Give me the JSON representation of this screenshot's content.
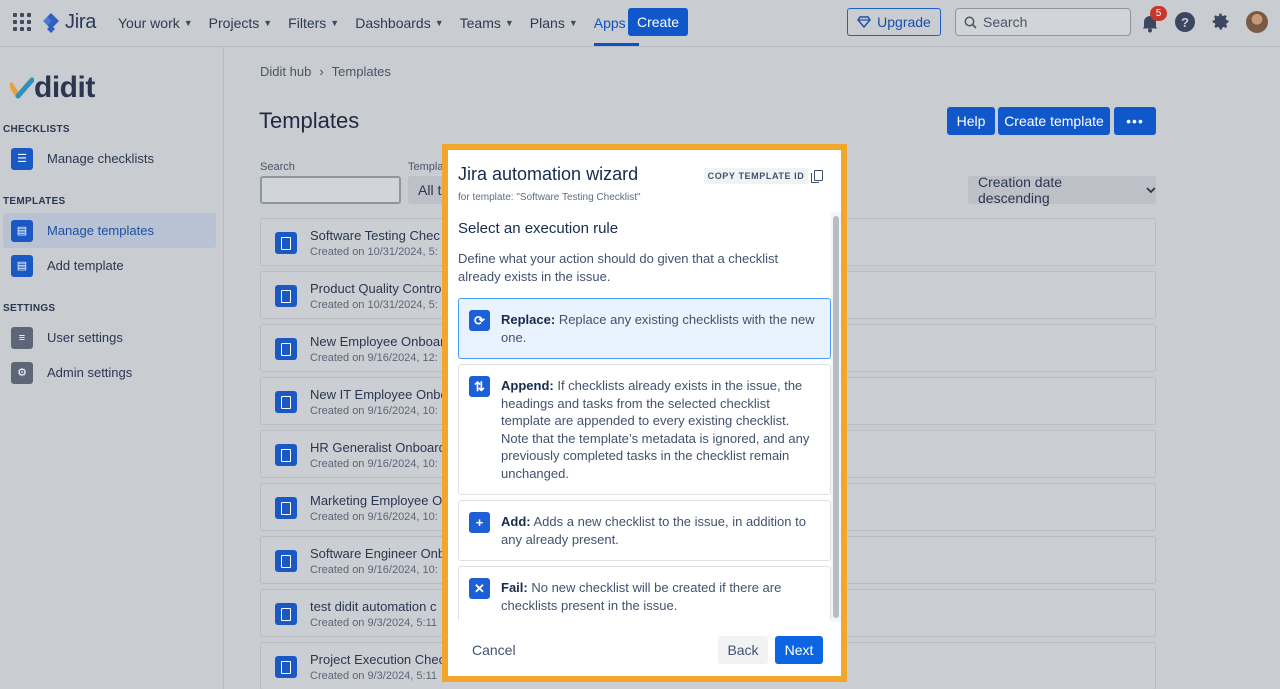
{
  "topnav": {
    "product": "Jira",
    "items": [
      {
        "label": "Your work"
      },
      {
        "label": "Projects"
      },
      {
        "label": "Filters"
      },
      {
        "label": "Dashboards"
      },
      {
        "label": "Teams"
      },
      {
        "label": "Plans"
      },
      {
        "label": "Apps",
        "active": true
      }
    ],
    "create_label": "Create",
    "upgrade_label": "Upgrade",
    "search_placeholder": "Search",
    "notification_count": "5",
    "help_glyph": "?",
    "icons": [
      "app-grid-icon",
      "upgrade-gem-icon",
      "search-icon",
      "bell-icon",
      "help-icon",
      "gear-icon",
      "avatar"
    ]
  },
  "sidebar": {
    "logo": "didit",
    "sections": [
      {
        "title": "CHECKLISTS",
        "items": [
          {
            "label": "Manage checklists",
            "icon": "checklist-icon"
          }
        ]
      },
      {
        "title": "TEMPLATES",
        "items": [
          {
            "label": "Manage templates",
            "icon": "template-icon",
            "selected": true
          },
          {
            "label": "Add template",
            "icon": "add-template-icon"
          }
        ]
      },
      {
        "title": "SETTINGS",
        "items": [
          {
            "label": "User settings",
            "icon": "sliders-icon"
          },
          {
            "label": "Admin settings",
            "icon": "admin-gear-icon"
          }
        ]
      }
    ]
  },
  "main": {
    "breadcrumb": [
      "Didit hub",
      "Templates"
    ],
    "breadcrumb_sep": "›",
    "title": "Templates",
    "help_label": "Help",
    "create_template_label": "Create template",
    "more_label": "•••",
    "search_label": "Search",
    "template_filter_label": "Templa",
    "template_filter_value": "All t",
    "sort_value": "Creation date descending",
    "templates": [
      {
        "name": "Software Testing Chec",
        "created": "Created on 10/31/2024, 5:"
      },
      {
        "name": "Product Quality Contro",
        "created": "Created on 10/31/2024, 5:"
      },
      {
        "name": "New Employee Onboar",
        "created": "Created on 9/16/2024, 12:"
      },
      {
        "name": "New IT Employee Onbo",
        "created": "Created on 9/16/2024, 10:"
      },
      {
        "name": "HR Generalist Onboard",
        "created": "Created on 9/16/2024, 10:"
      },
      {
        "name": "Marketing Employee O",
        "created": "Created on 9/16/2024, 10:"
      },
      {
        "name": "Software Engineer Onb",
        "created": "Created on 9/16/2024, 10:"
      },
      {
        "name": "test didit automation c",
        "created": "Created on 9/3/2024, 5:11"
      },
      {
        "name": "Project Execution Chec",
        "created": "Created on 9/3/2024, 5:11"
      }
    ]
  },
  "modal": {
    "title": "Jira automation wizard",
    "subtitle": "for template: \"Software Testing Checklist\"",
    "copy_id_label": "COPY TEMPLATE ID",
    "section_title": "Select an execution rule",
    "section_desc": "Define what your action should do given that a checklist already exists in the issue.",
    "options": [
      {
        "key": "Replace:",
        "text": " Replace any existing checklists with the new one.",
        "icon": "replace-icon",
        "glyph": "⟳",
        "selected": true
      },
      {
        "key": "Append:",
        "text": " If checklists already exists in the issue, the headings and tasks from the selected checklist template are appended to every existing checklist. Note that the template’s metadata is ignored, and any previously completed tasks in the checklist remain unchanged.",
        "icon": "append-icon",
        "glyph": "⇅",
        "selected": false
      },
      {
        "key": "Add:",
        "text": " Adds a new checklist to the issue, in addition to any already present.",
        "icon": "add-icon",
        "glyph": "+",
        "selected": false
      },
      {
        "key": "Fail:",
        "text": " No new checklist will be created if there are checklists present in the issue.",
        "icon": "fail-icon",
        "glyph": "✕",
        "selected": false
      }
    ],
    "cancel_label": "Cancel",
    "back_label": "Back",
    "next_label": "Next"
  },
  "colors": {
    "brand_blue": "#0c66e4",
    "highlight_frame": "#f3a62c",
    "selected_option_bg": "#e9f2ff"
  }
}
